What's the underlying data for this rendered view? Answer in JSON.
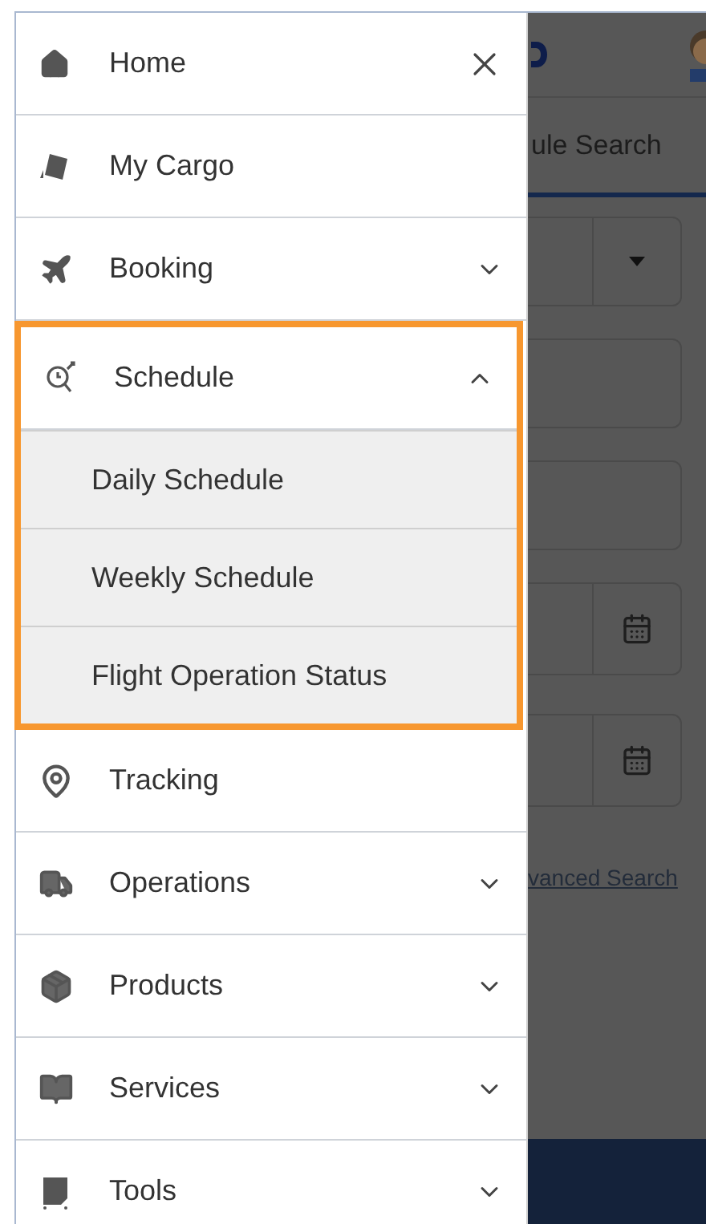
{
  "drawer": {
    "items": [
      {
        "label": "Home",
        "kind": "close"
      },
      {
        "label": "My Cargo",
        "kind": "plain"
      },
      {
        "label": "Booking",
        "kind": "group",
        "expanded": false
      },
      {
        "label": "Schedule",
        "kind": "group",
        "expanded": true,
        "highlighted": true,
        "children": [
          {
            "label": "Daily Schedule"
          },
          {
            "label": "Weekly Schedule"
          },
          {
            "label": "Flight Operation Status"
          }
        ]
      },
      {
        "label": "Tracking",
        "kind": "plain"
      },
      {
        "label": "Operations",
        "kind": "group",
        "expanded": false
      },
      {
        "label": "Products",
        "kind": "group",
        "expanded": false
      },
      {
        "label": "Services",
        "kind": "group",
        "expanded": false
      },
      {
        "label": "Tools",
        "kind": "group",
        "expanded": false
      }
    ]
  },
  "background": {
    "tab": "ule Search",
    "link": "vanced Search"
  }
}
